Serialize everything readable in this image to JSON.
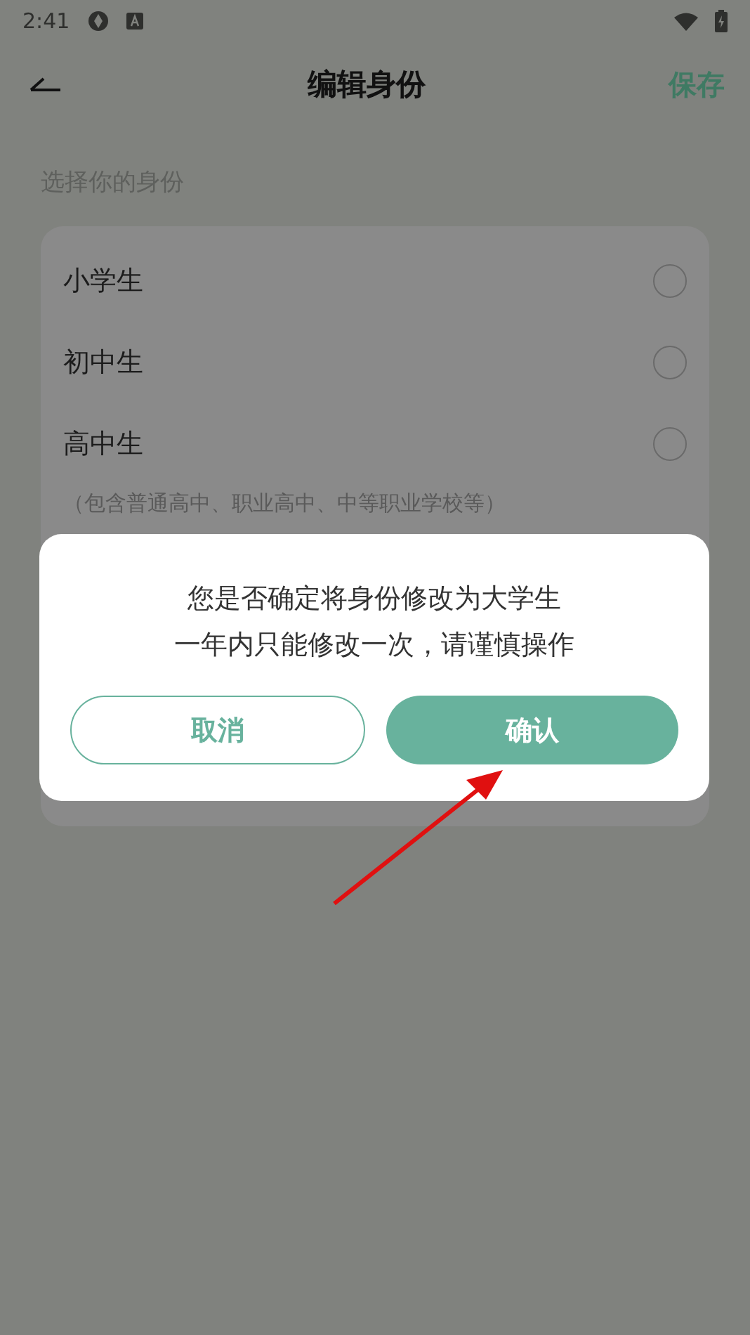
{
  "status_bar": {
    "time": "2:41"
  },
  "header": {
    "title": "编辑身份",
    "action": "保存"
  },
  "section_label": "选择你的身份",
  "options": [
    {
      "label": "小学生",
      "selected": false
    },
    {
      "label": "初中生",
      "selected": false
    },
    {
      "label": "高中生",
      "selected": false
    }
  ],
  "note": "（包含普通高中、职业高中、中等职业学校等）",
  "dialog": {
    "lines": [
      "您是否确定将身份修改为大学生",
      "一年内只能修改一次，请谨慎操作"
    ],
    "cancel": "取消",
    "confirm": "确认"
  }
}
